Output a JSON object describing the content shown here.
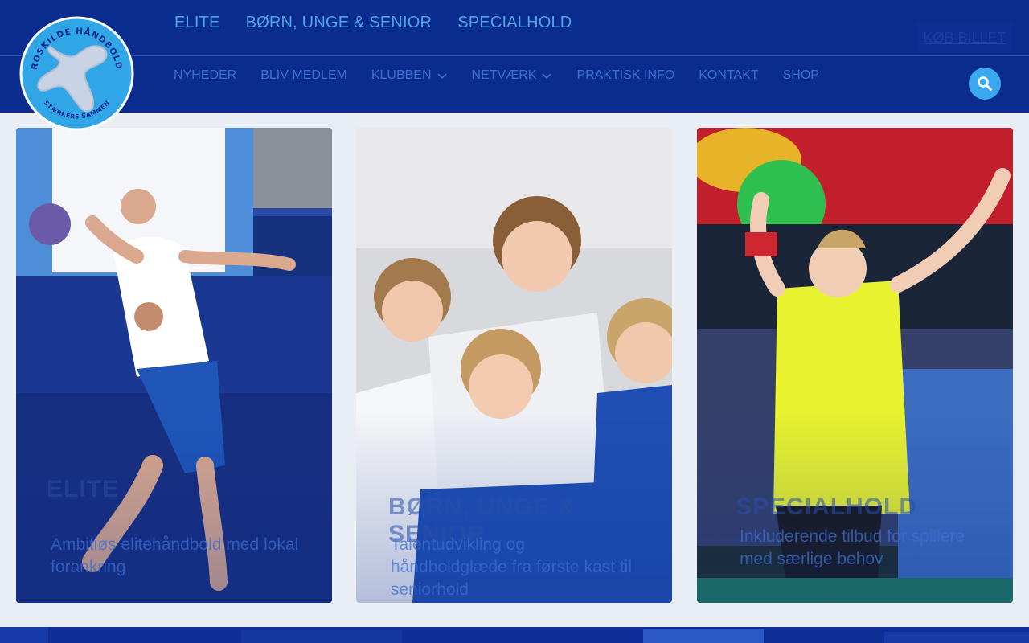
{
  "brand": {
    "ring_text_top": "ROSKILDE HÅNDBOLD",
    "ring_text_bottom": "STÆRKERE SAMMEN"
  },
  "top_nav": [
    "ELITE",
    "BØRN, UNGE & SENIOR",
    "SPECIALHOLD"
  ],
  "buy_button": "KØB BILLET",
  "main_nav": [
    {
      "label": "NYHEDER",
      "dropdown": false
    },
    {
      "label": "BLIV MEDLEM",
      "dropdown": false
    },
    {
      "label": "KLUBBEN",
      "dropdown": true
    },
    {
      "label": "NETVÆRK",
      "dropdown": true
    },
    {
      "label": "PRAKTISK INFO",
      "dropdown": false
    },
    {
      "label": "KONTAKT",
      "dropdown": false
    },
    {
      "label": "SHOP",
      "dropdown": false
    }
  ],
  "search": {
    "icon": "search-icon"
  },
  "cards": [
    {
      "category": "ELITE",
      "description": "Ambitiøs elitehåndbold med lokal forankring"
    },
    {
      "category": "BØRN, UNGE & SENIOR",
      "description": "Talentudvikling og håndboldglæde fra første kast til seniorhold"
    },
    {
      "category": "SPECIALHOLD",
      "description": "Inkluderende tilbud for spillere med særlige behov"
    }
  ],
  "colors": {
    "header_bg": "#0a2c8e",
    "accent_light_blue": "#3aa8ee",
    "page_bg": "#e9eef5"
  }
}
